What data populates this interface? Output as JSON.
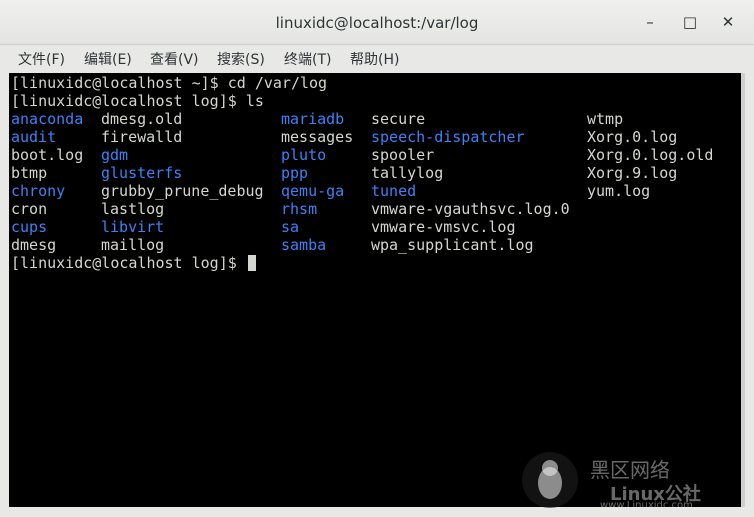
{
  "window": {
    "title": "linuxidc@localhost:/var/log",
    "buttons": [
      "–",
      "□",
      "✕"
    ],
    "minimize_icon": "minimize-icon",
    "maximize_icon": "maximize-icon",
    "close_icon": "close-icon"
  },
  "menu": [
    "文件(F)",
    "编辑(E)",
    "查看(V)",
    "搜索(S)",
    "终端(T)",
    "帮助(H)"
  ],
  "terminal": {
    "prompt1": "[linuxidc@localhost ~]$ cd /var/log",
    "prompt2": "[linuxidc@localhost log]$ ls",
    "prompt3": "[linuxidc@localhost log]$ ",
    "columns": [
      [
        {
          "name": "anaconda",
          "dir": true
        },
        {
          "name": "audit",
          "dir": true
        },
        {
          "name": "boot.log",
          "dir": false
        },
        {
          "name": "btmp",
          "dir": false
        },
        {
          "name": "chrony",
          "dir": true
        },
        {
          "name": "cron",
          "dir": false
        },
        {
          "name": "cups",
          "dir": true
        },
        {
          "name": "dmesg",
          "dir": false
        }
      ],
      [
        {
          "name": "dmesg.old",
          "dir": false
        },
        {
          "name": "firewalld",
          "dir": false
        },
        {
          "name": "gdm",
          "dir": true
        },
        {
          "name": "glusterfs",
          "dir": true
        },
        {
          "name": "grubby_prune_debug",
          "dir": false
        },
        {
          "name": "lastlog",
          "dir": false
        },
        {
          "name": "libvirt",
          "dir": true
        },
        {
          "name": "maillog",
          "dir": false
        }
      ],
      [
        {
          "name": "mariadb",
          "dir": true
        },
        {
          "name": "messages",
          "dir": false
        },
        {
          "name": "pluto",
          "dir": true
        },
        {
          "name": "ppp",
          "dir": true
        },
        {
          "name": "qemu-ga",
          "dir": true
        },
        {
          "name": "rhsm",
          "dir": true
        },
        {
          "name": "sa",
          "dir": true
        },
        {
          "name": "samba",
          "dir": true
        }
      ],
      [
        {
          "name": "secure",
          "dir": false
        },
        {
          "name": "speech-dispatcher",
          "dir": true
        },
        {
          "name": "spooler",
          "dir": false
        },
        {
          "name": "tallylog",
          "dir": false
        },
        {
          "name": "tuned",
          "dir": true
        },
        {
          "name": "vmware-vgauthsvc.log.0",
          "dir": false
        },
        {
          "name": "vmware-vmsvc.log",
          "dir": false
        },
        {
          "name": "wpa_supplicant.log",
          "dir": false
        }
      ],
      [
        {
          "name": "wtmp",
          "dir": false
        },
        {
          "name": "Xorg.0.log",
          "dir": false
        },
        {
          "name": "Xorg.0.log.old",
          "dir": false
        },
        {
          "name": "Xorg.9.log",
          "dir": false
        },
        {
          "name": "yum.log",
          "dir": false
        }
      ]
    ]
  },
  "watermark": {
    "line1": "黑区网络",
    "line2": "Linux公社",
    "line3": "www.Linuxidc.com"
  },
  "colors": {
    "directory": "#3b82f6",
    "text": "#d3d7cf",
    "background": "#000000"
  }
}
